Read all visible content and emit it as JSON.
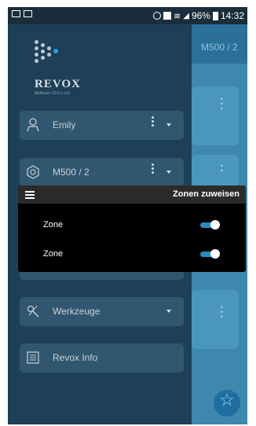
{
  "status_bar": {
    "battery": "96%",
    "time": "14:32"
  },
  "background": {
    "title": "M500 / 2"
  },
  "drawer": {
    "brand": "REVOX",
    "version": "Multiuser V3.0.1-rc2",
    "items": [
      {
        "label": "Emily",
        "icon": "user-icon"
      },
      {
        "label": "M500 / 2",
        "icon": "speaker-icon"
      },
      {
        "label": "",
        "icon": "hidden-item"
      },
      {
        "label": "Werkzeuge",
        "icon": "tools-icon"
      },
      {
        "label": "Revox Info",
        "icon": "info-icon"
      }
    ]
  },
  "dialog": {
    "title": "Zonen zuweisen",
    "zones": [
      {
        "label": "Zone",
        "on": true
      },
      {
        "label": "Zone",
        "on": true
      }
    ]
  },
  "colors": {
    "drawer": "#1d4058",
    "menu_item": "#31566f",
    "accent": "#2b8ac4",
    "dialog": "#000000"
  }
}
